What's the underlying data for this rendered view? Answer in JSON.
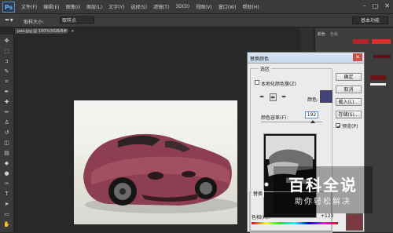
{
  "app": {
    "logo_text": "Ps"
  },
  "menu": [
    "文件(F)",
    "编辑(E)",
    "图像(I)",
    "图层(L)",
    "文字(Y)",
    "选择(S)",
    "滤镜(T)",
    "3D(D)",
    "视图(V)",
    "窗口(W)",
    "帮助(H)"
  ],
  "window_controls": [
    "–",
    "□",
    "✕"
  ],
  "options_bar": {
    "sample_size_label": "取样大小:",
    "sample_size_value": "取样点",
    "workspace": "基本功能"
  },
  "document": {
    "tab_label": "pao.jpg @ 100%(RGB/8#)",
    "close": "×"
  },
  "panels": {
    "color_tab": "颜色",
    "swatches_tab": "色板"
  },
  "dialog": {
    "title": "替换颜色",
    "close": "✕",
    "buttons": {
      "ok": "确定",
      "cancel": "取消",
      "load": "载入(L)...",
      "save": "存储(S)...",
      "preview": "预览(P)"
    },
    "selection_group": "选区",
    "localized_clusters": "本地化颜色簇(Z)",
    "color_label": "颜色:",
    "fuzziness_label": "颜色容差(F):",
    "fuzziness_value": "192",
    "selection_radio": "选",
    "replace_group": "替换",
    "hue_label": "色相(H):",
    "hue_value": "+123"
  },
  "colors": {
    "sampled": "#42437a",
    "result": "#7a3b40",
    "car": "#8e3e52"
  },
  "watermark": {
    "title": "百科全说",
    "subtitle": "助你轻松解决"
  }
}
